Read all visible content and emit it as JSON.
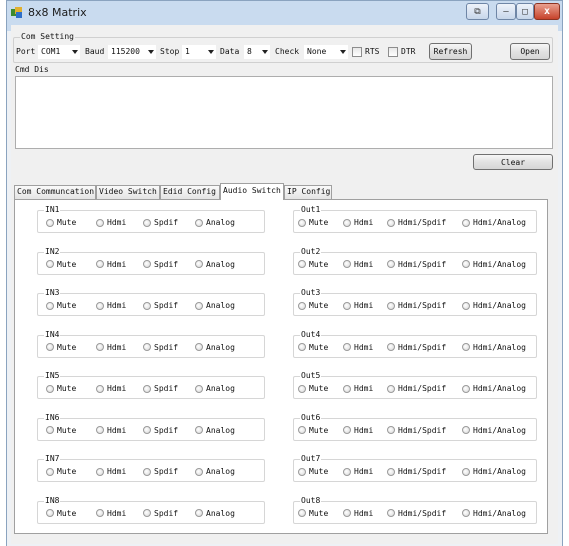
{
  "window": {
    "title": "8x8 Matrix",
    "accent": "#c9dbef",
    "close_glyph": "x",
    "minimize_glyph": "–",
    "maximize_glyph": "□",
    "restore_glyph": "⧉"
  },
  "com_setting": {
    "label": "Com Setting",
    "port_label": "Port",
    "port_value": "COM1",
    "baud_label": "Baud",
    "baud_value": "115200",
    "stop_label": "Stop",
    "stop_value": "1",
    "data_label": "Data",
    "data_value": "8",
    "check_label": "Check",
    "check_value": "None",
    "rts_label": "RTS",
    "dtr_label": "DTR",
    "refresh_label": "Refresh",
    "open_label": "Open"
  },
  "cmd_dis": {
    "label": "Cmd Dis",
    "clear_label": "Clear"
  },
  "tabs": [
    {
      "label": "Com Communcation"
    },
    {
      "label": "Video Switch"
    },
    {
      "label": "Edid Config"
    },
    {
      "label": "Audio Switch"
    },
    {
      "label": "IP Config"
    }
  ],
  "active_tab": "Audio Switch",
  "inputs": [
    {
      "label": "IN1"
    },
    {
      "label": "IN2"
    },
    {
      "label": "IN3"
    },
    {
      "label": "IN4"
    },
    {
      "label": "IN5"
    },
    {
      "label": "IN6"
    },
    {
      "label": "IN7"
    },
    {
      "label": "IN8"
    }
  ],
  "outputs": [
    {
      "label": "Out1"
    },
    {
      "label": "Out2"
    },
    {
      "label": "Out3"
    },
    {
      "label": "Out4"
    },
    {
      "label": "Out5"
    },
    {
      "label": "Out6"
    },
    {
      "label": "Out7"
    },
    {
      "label": "Out8"
    }
  ],
  "in_options": [
    "Mute",
    "Hdmi",
    "Spdif",
    "Analog"
  ],
  "out_options": [
    "Mute",
    "Hdmi",
    "Hdmi/Spdif",
    "Hdmi/Analog"
  ]
}
